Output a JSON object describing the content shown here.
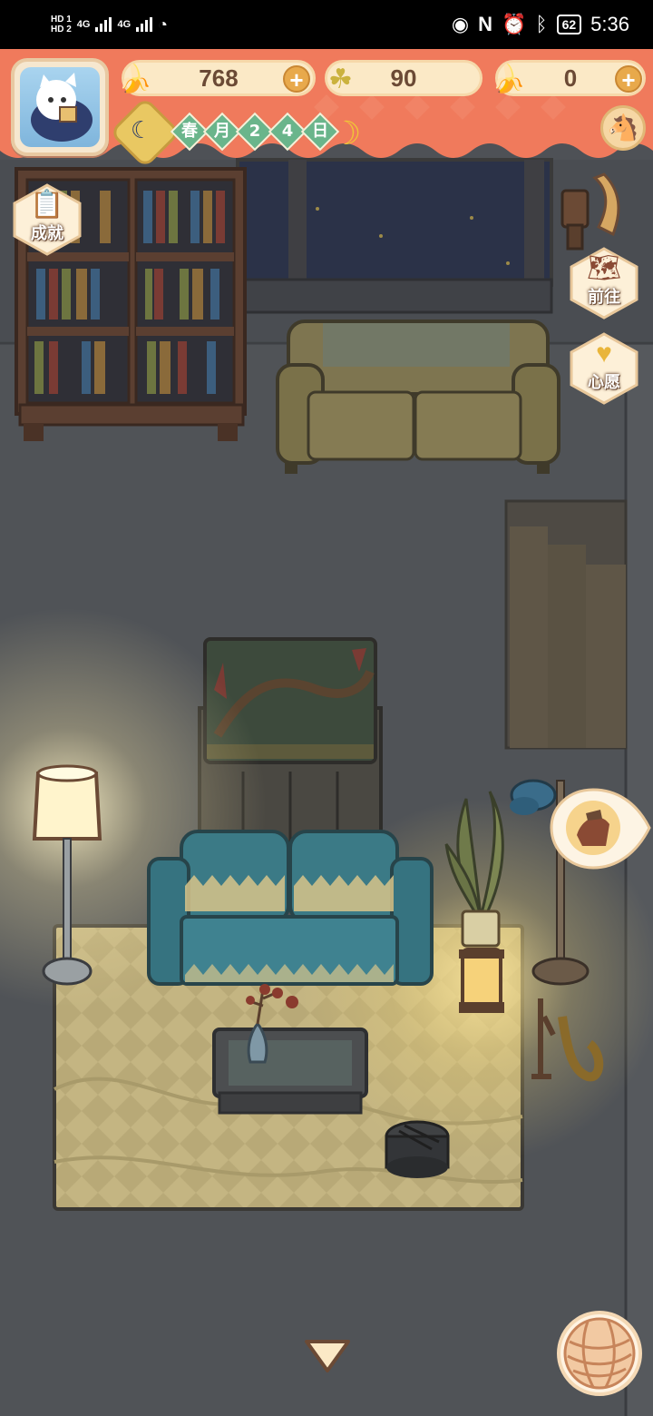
{
  "status_bar": {
    "hd_top": "HD 1",
    "hd_bottom": "HD 2",
    "net1": "4G",
    "net2": "4G",
    "battery": "62",
    "time": "5:36"
  },
  "hud": {
    "bananas": "768",
    "clovers": "90",
    "blue_bananas": "0",
    "date_chars": [
      "春",
      "月",
      "2",
      "4",
      "日"
    ]
  },
  "side_buttons": {
    "achievements": "成就",
    "goto": "前往",
    "wish": "心愿"
  },
  "icons": {
    "banana": "banana-icon",
    "clover": "clover-icon",
    "blue_banana": "blue-banana-icon",
    "moon": "moon-icon",
    "yarn": "yarn-ball-icon"
  },
  "colors": {
    "hud_banner": "#f07a5c",
    "pill": "#fbe9c6",
    "chip_green": "#6ab58b",
    "room_dark": "#4e5156"
  }
}
